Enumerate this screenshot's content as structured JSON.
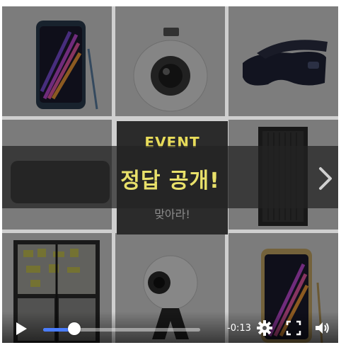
{
  "overlay": {
    "answer_text": "정답 공개!",
    "event_title": "EVENT",
    "event_subtitle": "맞아라!"
  },
  "player": {
    "remaining_time": "-0:13",
    "progress": 0.2,
    "icons": [
      "play-icon",
      "settings-gear-icon",
      "fullscreen-icon",
      "volume-icon",
      "next-arrow-icon"
    ],
    "accent_color": "#4a7dff",
    "highlight_text_color": "#e8e06a"
  },
  "products": [
    "phone-note7-blue",
    "gear-360-camera",
    "gear-vr-headset",
    "tv-panel",
    "event-panel",
    "speaker-tower",
    "refrigerator",
    "gear-360-tripod",
    "phone-note7-gold"
  ]
}
